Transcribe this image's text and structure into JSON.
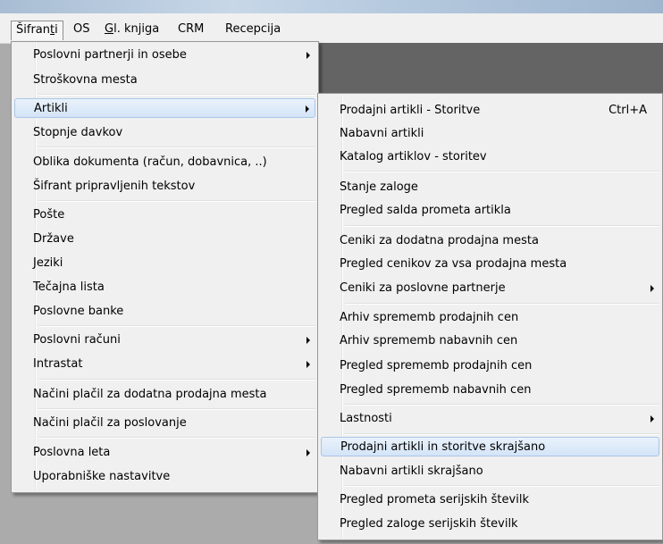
{
  "menubar": {
    "items": [
      {
        "label_pre": "Šifran",
        "label_u": "t",
        "label_post": "i"
      },
      {
        "label_pre": "",
        "label_u": "",
        "label_post": "OS"
      },
      {
        "label_pre": "",
        "label_u": "G",
        "label_post": "l. knjiga"
      },
      {
        "label_pre": "",
        "label_u": "",
        "label_post": "CRM"
      },
      {
        "label_pre": "",
        "label_u": "",
        "label_post": "Recepcija"
      }
    ]
  },
  "main_menu": {
    "items": [
      {
        "label": "Poslovni partnerji in osebe"
      },
      {
        "label": "Stroškovna mesta"
      },
      {
        "label": "Artikli"
      },
      {
        "label": "Stopnje davkov"
      },
      {
        "label": "Oblika dokumenta (račun, dobavnica, ..)"
      },
      {
        "label": "Šifrant pripravljenih tekstov"
      },
      {
        "label": "Pošte"
      },
      {
        "label": "Države"
      },
      {
        "label": "Jeziki"
      },
      {
        "label": "Tečajna lista"
      },
      {
        "label": "Poslovne banke"
      },
      {
        "label": "Poslovni računi"
      },
      {
        "label": "Intrastat"
      },
      {
        "label": "Načini plačil za dodatna prodajna mesta"
      },
      {
        "label": "Načini plačil za poslovanje"
      },
      {
        "label": "Poslovna leta"
      },
      {
        "label": "Uporabniške nastavitve"
      }
    ]
  },
  "sub_menu": {
    "items": [
      {
        "label": "Prodajni artikli - Storitve",
        "shortcut": "Ctrl+A"
      },
      {
        "label": "Nabavni artikli"
      },
      {
        "label": "Katalog artiklov - storitev"
      },
      {
        "label": "Stanje zaloge"
      },
      {
        "label": "Pregled salda prometa artikla"
      },
      {
        "label": "Ceniki za dodatna prodajna mesta"
      },
      {
        "label": "Pregled cenikov za vsa prodajna mesta"
      },
      {
        "label": "Ceniki za poslovne partnerje"
      },
      {
        "label": "Arhiv sprememb prodajnih cen"
      },
      {
        "label": "Arhiv sprememb nabavnih cen"
      },
      {
        "label": "Pregled sprememb prodajnih cen"
      },
      {
        "label": "Pregled sprememb nabavnih cen"
      },
      {
        "label": "Lastnosti"
      },
      {
        "label": "Prodajni artikli in storitve skrajšano"
      },
      {
        "label": "Nabavni artikli skrajšano"
      },
      {
        "label": "Pregled prometa serijskih številk"
      },
      {
        "label": "Pregled zaloge serijskih številk"
      }
    ]
  },
  "colors": {
    "app_background": "#ababab",
    "menu_background": "#f0f0f0",
    "highlight": "#d3e4f7",
    "highlight_border": "#a9c6e8"
  },
  "icons": {
    "submenu_arrow": "submenu-arrow-icon"
  }
}
